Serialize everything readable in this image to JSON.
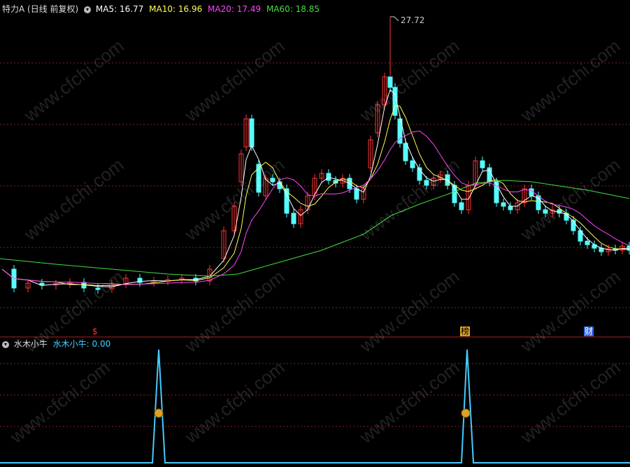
{
  "main_panel": {
    "title": "特力A",
    "mode": "(日线 前复权)",
    "indicators": [
      {
        "label": "MA5:",
        "value": "16.77",
        "color": "#ffffff"
      },
      {
        "label": "MA10:",
        "value": "16.96",
        "color": "#ffff55"
      },
      {
        "label": "MA20:",
        "value": "17.49",
        "color": "#ff44ff"
      },
      {
        "label": "MA60:",
        "value": "18.85",
        "color": "#44dd44"
      }
    ],
    "peak_label": "27.72",
    "event_markers": [
      "$",
      "榜",
      "财"
    ]
  },
  "sub_panel": {
    "title": "水木小牛",
    "indicator_label": "水木小牛:",
    "indicator_value": "0.00",
    "indicator_color": "#44ccff"
  },
  "watermark": "www.cfchi.com",
  "colors": {
    "up": "#ff3333",
    "down": "#55ffff",
    "grid": "#882222",
    "ma5": "#ffffff",
    "ma10": "#ffff55",
    "ma20": "#ff44ff",
    "ma60": "#44dd44",
    "signal": "#44ccff"
  }
}
